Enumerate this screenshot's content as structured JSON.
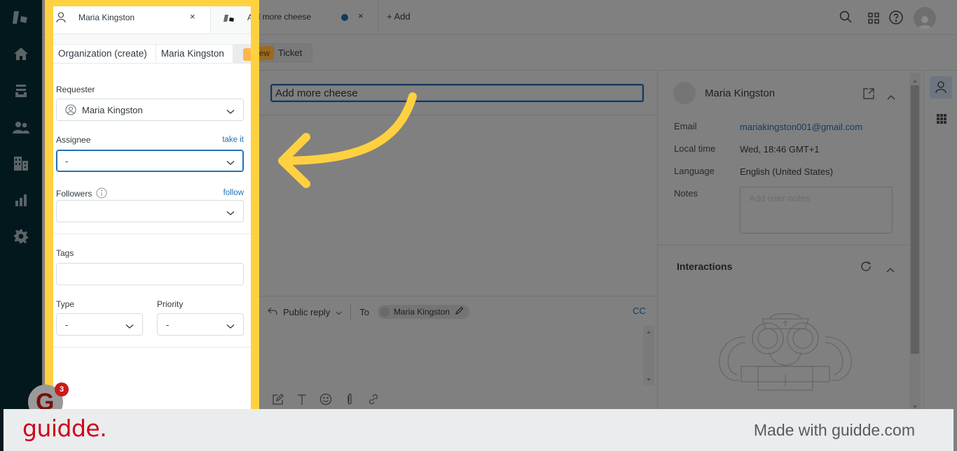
{
  "left_nav": {
    "items": [
      "logo",
      "home",
      "views",
      "customers",
      "organizations",
      "reporting",
      "admin"
    ]
  },
  "tabs": [
    {
      "label": "Maria Kingston",
      "icon": "user-icon",
      "close": "×"
    },
    {
      "label": "Add more cheese",
      "icon": "ticket-icon",
      "unsaved_dot": true,
      "close": "×"
    }
  ],
  "add_tab": "+ Add",
  "header_icons": [
    "search-icon",
    "apps-icon",
    "help-icon",
    "avatar"
  ],
  "breadcrumbs": [
    {
      "label": "Organization (create)"
    },
    {
      "label": "Maria Kingston"
    },
    {
      "badge": "New",
      "label": "Ticket"
    }
  ],
  "properties": {
    "requester": {
      "label": "Requester",
      "value": "Maria Kingston"
    },
    "assignee": {
      "label": "Assignee",
      "link": "take it",
      "value": "-"
    },
    "followers": {
      "label": "Followers",
      "link": "follow",
      "value": ""
    },
    "tags": {
      "label": "Tags",
      "value": ""
    },
    "type": {
      "label": "Type",
      "value": "-"
    },
    "priority": {
      "label": "Priority",
      "value": "-"
    }
  },
  "ticket": {
    "subject": "Add more cheese",
    "reply_mode": "Public reply",
    "to_label": "To",
    "to_recipient": "Maria Kingston",
    "cc_label": "CC",
    "toolbar_icons": [
      "compose-icon",
      "text-format-icon",
      "emoji-icon",
      "attachment-icon",
      "link-icon"
    ]
  },
  "user_panel": {
    "name": "Maria Kingston",
    "fields": [
      {
        "label": "Email",
        "value": "mariakingston001@gmail.com"
      },
      {
        "label": "Local time",
        "value": "Wed, 18:46 GMT+1"
      },
      {
        "label": "Language",
        "value": "English (United States)"
      },
      {
        "label": "Notes",
        "placeholder": "Add user notes"
      }
    ],
    "interactions_title": "Interactions"
  },
  "widget": {
    "badge_count": "3"
  },
  "footer": {
    "logo": "guidde.",
    "tagline": "Made with guidde.com"
  },
  "colors": {
    "highlight": "#ffd140",
    "link": "#1f73b7",
    "brand_red": "#d0021b",
    "nav_bg": "#03181d"
  }
}
